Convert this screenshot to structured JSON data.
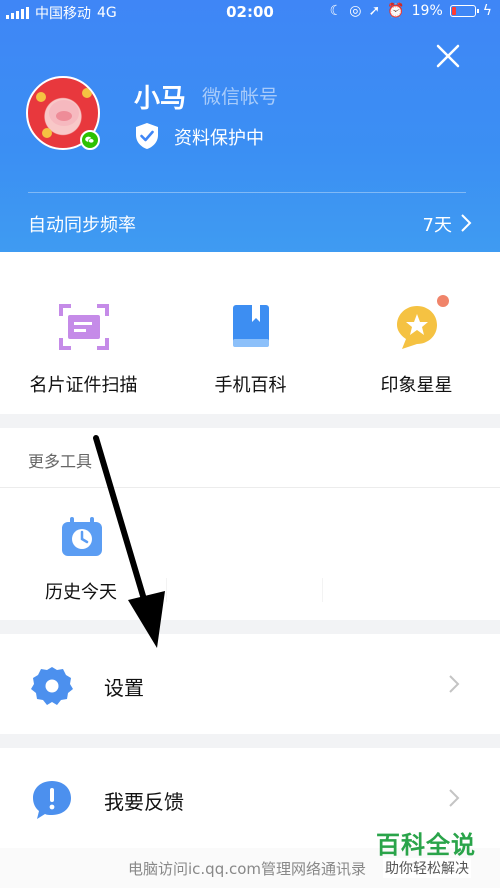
{
  "status_bar": {
    "carrier": "中国移动",
    "network": "4G",
    "time": "02:00",
    "battery_percent": "19%",
    "battery_level": 0.19
  },
  "profile": {
    "name": "小马",
    "account_type": "微信帐号",
    "protection_status": "资料保护中"
  },
  "sync": {
    "label": "自动同步频率",
    "value": "7天"
  },
  "tools": [
    {
      "label": "名片证件扫描",
      "icon": "card-scan-icon"
    },
    {
      "label": "手机百科",
      "icon": "book-icon"
    },
    {
      "label": "印象星星",
      "icon": "star-bubble-icon"
    }
  ],
  "more_tools": {
    "title": "更多工具",
    "items": [
      {
        "label": "历史今天",
        "icon": "calendar-clock-icon"
      }
    ]
  },
  "menu": {
    "settings": "设置",
    "feedback": "我要反馈"
  },
  "caption": "电脑访问ic.qq.com管理网络通讯录",
  "watermark": {
    "title": "百科全说",
    "subtitle": "助你轻松解决"
  },
  "colors": {
    "header_blue": "#3f86f6",
    "accent_blue": "#3d8ef2",
    "tool_purple": "#c58be8",
    "star_yellow": "#f5c242",
    "notification_dot": "#f0846a",
    "wechat_green": "#2dc100"
  }
}
